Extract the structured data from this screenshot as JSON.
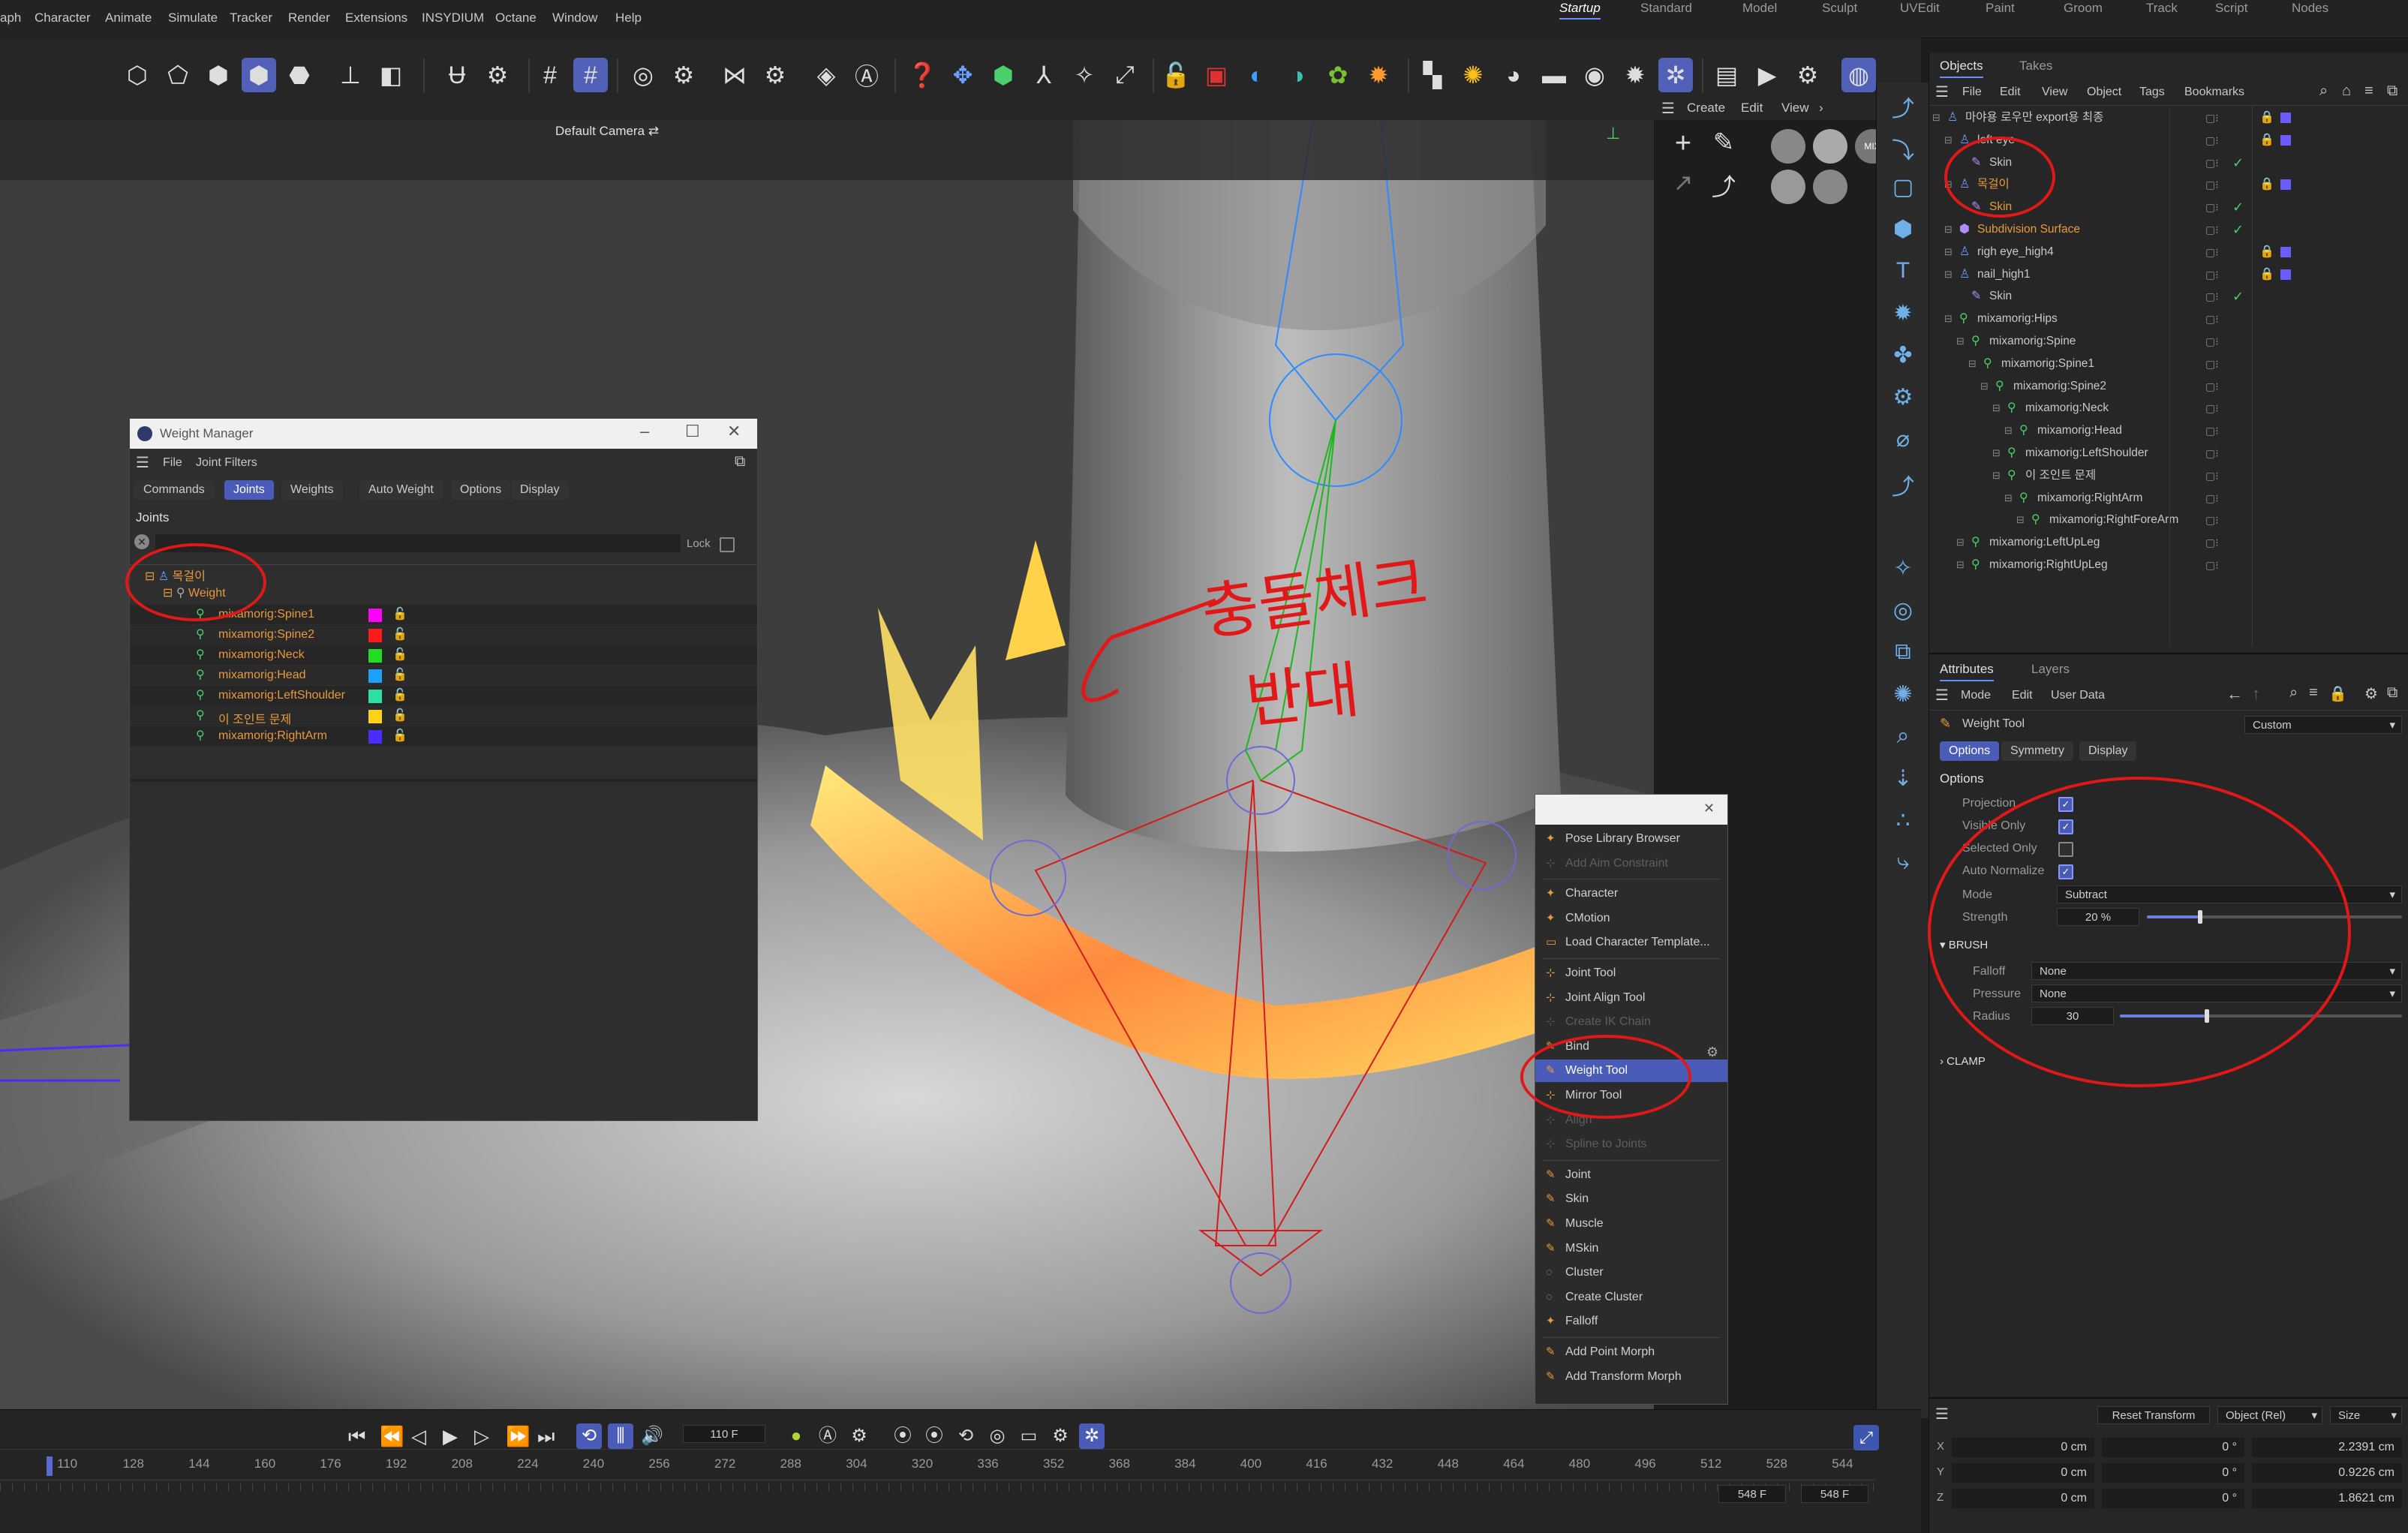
{
  "menubar": {
    "items": [
      "aph",
      "Character",
      "Animate",
      "Simulate",
      "Tracker",
      "Render",
      "Extensions",
      "INSYDIUM",
      "Octane",
      "Window",
      "Help"
    ],
    "layouts": [
      "Startup",
      "Standard",
      "Model",
      "Sculpt",
      "UVEdit",
      "Paint",
      "Groom",
      "Track",
      "Script",
      "Nodes"
    ],
    "active_layout": "Startup"
  },
  "viewport": {
    "camera_label": "Default Camera",
    "annotation_line1": "충돌체크",
    "annotation_line2": "반대"
  },
  "palette": {
    "menu": [
      "Create",
      "Edit",
      "View"
    ]
  },
  "weight_manager": {
    "title": "Weight Manager",
    "menu": [
      "File",
      "Joint Filters"
    ],
    "tabs": [
      "Commands",
      "Joints",
      "Weights",
      "Auto Weight",
      "Options",
      "Display"
    ],
    "active_tab": "Joints",
    "section": "Joints",
    "lock_label": "Lock",
    "root": "목걸이",
    "tag": "Weight",
    "joints": [
      {
        "name": "mixamorig:Spine1",
        "color": "#ff00ff"
      },
      {
        "name": "mixamorig:Spine2",
        "color": "#ff1a1a"
      },
      {
        "name": "mixamorig:Neck",
        "color": "#22dd22"
      },
      {
        "name": "mixamorig:Head",
        "color": "#1ea0ff"
      },
      {
        "name": "mixamorig:LeftShoulder",
        "color": "#2de0a6"
      },
      {
        "name": "이 조인트 문제",
        "color": "#ffd21a"
      },
      {
        "name": "mixamorig:RightArm",
        "color": "#4a2cff"
      }
    ]
  },
  "popup_menu": {
    "items": [
      {
        "label": "Pose Library Browser",
        "enabled": true,
        "icon": "pose-library-icon",
        "glyph": "✦"
      },
      {
        "label": "Add Aim Constraint",
        "enabled": false,
        "icon": "aim-constraint-icon",
        "glyph": "⊹"
      },
      {
        "sep": true
      },
      {
        "label": "Character",
        "enabled": true,
        "icon": "character-icon",
        "glyph": "✦"
      },
      {
        "label": "CMotion",
        "enabled": true,
        "icon": "cmotion-icon",
        "glyph": "✦"
      },
      {
        "label": "Load Character Template...",
        "enabled": true,
        "icon": "folder-icon",
        "glyph": "▭"
      },
      {
        "sep": true
      },
      {
        "label": "Joint Tool",
        "enabled": true,
        "icon": "joint-tool-icon",
        "glyph": "⊹"
      },
      {
        "label": "Joint Align Tool",
        "enabled": true,
        "icon": "joint-align-icon",
        "glyph": "⊹"
      },
      {
        "label": "Create IK Chain",
        "enabled": false,
        "icon": "ik-chain-icon",
        "glyph": "⊹"
      },
      {
        "label": "Bind",
        "enabled": true,
        "icon": "bind-icon",
        "glyph": "✎"
      },
      {
        "label": "Weight Tool",
        "enabled": true,
        "icon": "weight-tool-icon",
        "glyph": "✎",
        "active": true
      },
      {
        "label": "Mirror Tool",
        "enabled": true,
        "icon": "mirror-tool-icon",
        "glyph": "⊹"
      },
      {
        "label": "Align",
        "enabled": false,
        "icon": "align-icon",
        "glyph": "⊹"
      },
      {
        "label": "Spline to Joints",
        "enabled": false,
        "icon": "spline-joints-icon",
        "glyph": "⊹"
      },
      {
        "sep": true
      },
      {
        "label": "Joint",
        "enabled": true,
        "icon": "joint-icon",
        "glyph": "✎"
      },
      {
        "label": "Skin",
        "enabled": true,
        "icon": "skin-icon",
        "glyph": "✎"
      },
      {
        "label": "Muscle",
        "enabled": true,
        "icon": "muscle-icon",
        "glyph": "✎"
      },
      {
        "label": "MSkin",
        "enabled": true,
        "icon": "mskin-icon",
        "glyph": "✎"
      },
      {
        "label": "Cluster",
        "enabled": true,
        "icon": "cluster-icon",
        "glyph": "◌"
      },
      {
        "label": "Create Cluster",
        "enabled": true,
        "icon": "create-cluster-icon",
        "glyph": "◌"
      },
      {
        "label": "Falloff",
        "enabled": true,
        "icon": "falloff-icon",
        "glyph": "✦"
      },
      {
        "sep": true
      },
      {
        "label": "Add Point Morph",
        "enabled": true,
        "icon": "point-morph-icon",
        "glyph": "✎"
      },
      {
        "label": "Add Transform Morph",
        "enabled": true,
        "icon": "transform-morph-icon",
        "glyph": "✎"
      }
    ]
  },
  "objects": {
    "tabs": [
      "Objects",
      "Takes"
    ],
    "menu": [
      "File",
      "Edit",
      "View",
      "Object",
      "Tags",
      "Bookmarks"
    ],
    "rows": [
      {
        "name": "마야용 로우만 export용 최종",
        "indent": 0,
        "type": "null",
        "check": false
      },
      {
        "name": "left eye",
        "indent": 1,
        "type": "mesh",
        "check": false
      },
      {
        "name": "Skin",
        "indent": 2,
        "type": "skin",
        "check": true
      },
      {
        "name": "목걸이",
        "indent": 1,
        "type": "mesh",
        "check": false,
        "highlight": true
      },
      {
        "name": "Skin",
        "indent": 2,
        "type": "skin",
        "check": true,
        "highlight": true
      },
      {
        "name": "Subdivision Surface",
        "indent": 1,
        "type": "sds",
        "check": true,
        "highlight": true
      },
      {
        "name": "righ eye_high4",
        "indent": 1,
        "type": "mesh",
        "check": false
      },
      {
        "name": "nail_high1",
        "indent": 1,
        "type": "mesh",
        "check": false
      },
      {
        "name": "Skin",
        "indent": 2,
        "type": "skin",
        "check": true
      },
      {
        "name": "mixamorig:Hips",
        "indent": 1,
        "type": "joint",
        "check": false
      },
      {
        "name": "mixamorig:Spine",
        "indent": 2,
        "type": "joint",
        "check": false
      },
      {
        "name": "mixamorig:Spine1",
        "indent": 3,
        "type": "joint",
        "check": false
      },
      {
        "name": "mixamorig:Spine2",
        "indent": 4,
        "type": "joint",
        "check": false
      },
      {
        "name": "mixamorig:Neck",
        "indent": 5,
        "type": "joint",
        "check": false
      },
      {
        "name": "mixamorig:Head",
        "indent": 6,
        "type": "joint",
        "check": false
      },
      {
        "name": "mixamorig:LeftShoulder",
        "indent": 5,
        "type": "joint",
        "check": false
      },
      {
        "name": "이 조인트 문제",
        "indent": 5,
        "type": "joint",
        "check": false
      },
      {
        "name": "mixamorig:RightArm",
        "indent": 6,
        "type": "joint",
        "check": false
      },
      {
        "name": "mixamorig:RightForeArm",
        "indent": 7,
        "type": "joint",
        "check": false
      },
      {
        "name": "mixamorig:LeftUpLeg",
        "indent": 2,
        "type": "joint",
        "check": false
      },
      {
        "name": "mixamorig:RightUpLeg",
        "indent": 2,
        "type": "joint",
        "check": false
      }
    ]
  },
  "attributes": {
    "tabs": [
      "Attributes",
      "Layers"
    ],
    "menu": [
      "Mode",
      "Edit",
      "User Data"
    ],
    "tool_name": "Weight Tool",
    "preset": "Custom",
    "subtabs": [
      "Options",
      "Symmetry",
      "Display"
    ],
    "active_subtab": "Options",
    "section": "Options",
    "projection": {
      "label": "Projection",
      "checked": true
    },
    "visible_only": {
      "label": "Visible Only",
      "checked": true
    },
    "selected_only": {
      "label": "Selected Only",
      "checked": false
    },
    "auto_normalize": {
      "label": "Auto Normalize",
      "checked": true
    },
    "mode": {
      "label": "Mode",
      "value": "Subtract"
    },
    "strength": {
      "label": "Strength",
      "value": "20 %",
      "fraction": 0.2
    },
    "brush_section": "BRUSH",
    "falloff": {
      "label": "Falloff",
      "value": "None"
    },
    "pressure": {
      "label": "Pressure",
      "value": "None"
    },
    "radius": {
      "label": "Radius",
      "value": "30",
      "fraction": 0.3
    },
    "clamp_section": "CLAMP"
  },
  "timeline": {
    "current_frame": "110 F",
    "ticks": [
      "110",
      "128",
      "144",
      "160",
      "176",
      "192",
      "208",
      "224",
      "240",
      "256",
      "272",
      "288",
      "304",
      "320",
      "336",
      "352",
      "368",
      "384",
      "400",
      "416",
      "432",
      "448",
      "464",
      "480",
      "496",
      "512",
      "528",
      "544"
    ],
    "end_frame_a": "548 F",
    "end_frame_b": "548 F"
  },
  "coordinates": {
    "reset_label": "Reset Transform",
    "space_label": "Object (Rel)",
    "size_label": "Size",
    "rows": [
      {
        "axis": "X",
        "pos": "0 cm",
        "rot": "0 °",
        "size": "2.2391 cm"
      },
      {
        "axis": "Y",
        "pos": "0 cm",
        "rot": "0 °",
        "size": "0.9226 cm"
      },
      {
        "axis": "Z",
        "pos": "0 cm",
        "rot": "0 °",
        "size": "1.8621 cm"
      }
    ]
  },
  "colors": {
    "accent": "#4b5cb8",
    "annotation": "#e01818",
    "necklace_warm": "#ff8a3d",
    "necklace_yellow": "#ffe066",
    "active_object": "#e89a3c"
  }
}
